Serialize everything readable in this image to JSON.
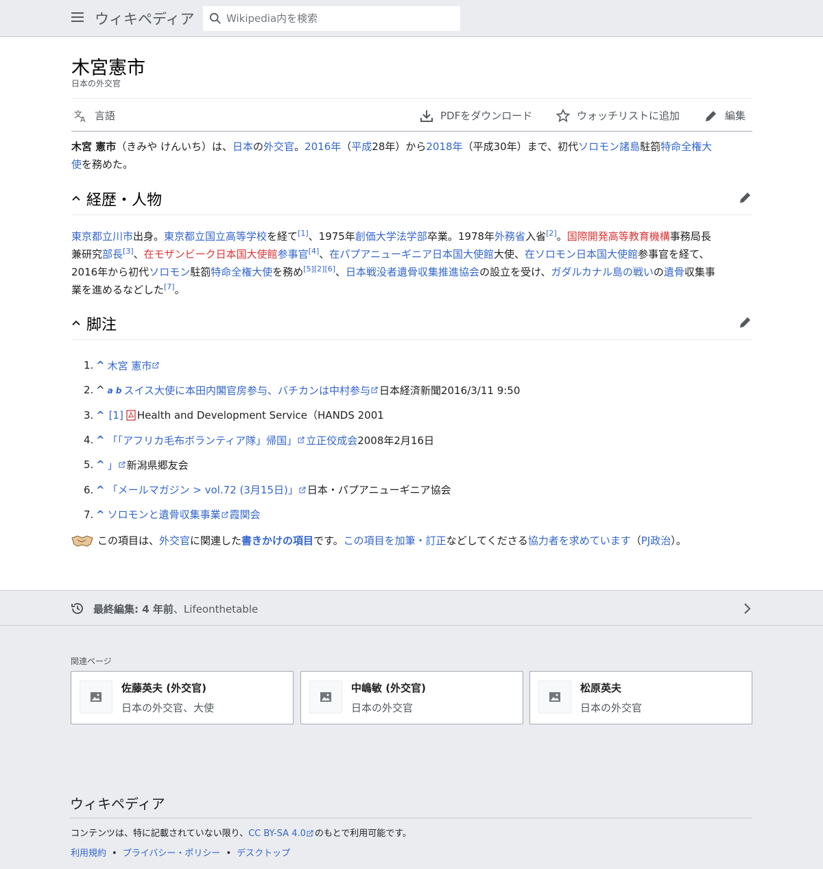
{
  "header": {
    "logo": "ウィキペディア",
    "search_placeholder": "Wikipedia内を検索"
  },
  "article": {
    "title": "木宮憲市",
    "tagline": "日本の外交官",
    "toolbar": {
      "language": "言語",
      "download_pdf": "PDFをダウンロード",
      "watchlist": "ウォッチリストに追加",
      "edit": "編集"
    },
    "lead": {
      "name": "木宮 憲市",
      "reading": "（きみや けんいち）は、",
      "japan": "日本",
      "no": "の",
      "diplomat": "外交官",
      "dot1": "。",
      "y2016": "2016年",
      "paren_open": "（",
      "heisei": "平成",
      "h28": "28年）から",
      "y2018": "2018年",
      "h30": "（平成30年）まで、初代",
      "solomon_islands": "ソロモン諸島",
      "chuzai": "駐箚",
      "ambassador_a": "特命全権大",
      "ambassador_b": "使",
      "served": "を務めた。"
    },
    "section1": {
      "heading": "経歴・人物",
      "t1": "東京都立川市",
      "t2": "出身。",
      "t3": "東京都立国立高等学校",
      "t4": "を経て",
      "r1": "[1]",
      "t5": "、1975年",
      "t6": "創価大学法学部",
      "t7": "卒業。1978年",
      "t8": "外務省",
      "t9": "入省",
      "r2": "[2]",
      "t10": "。",
      "t11": "国際開発高等教育機構",
      "t12": "事務局長",
      "t13": "兼研究",
      "t14": "部長",
      "r3": "[3]",
      "t15": "、",
      "t16": "在モザンビーク日本国大使館",
      "t17": "参事官",
      "r4": "[4]",
      "t18": "、",
      "t19": "在パプアニューギニア日本国大使館",
      "t20": "大使、",
      "t21": "在ソロモン日本国大使館",
      "t22": "参事官を経て、",
      "t23": "2016年から初代",
      "t24": "ソロモン",
      "t25": "駐箚",
      "t26": "特命全権大使",
      "t27": "を務め",
      "r5": "[5]",
      "r2b": "[2]",
      "r6": "[6]",
      "t28": "、",
      "t29": "日本戦没者遺骨収集推進協会",
      "t30": "の設立を受け、",
      "t31": "ガダルカナル島の戦い",
      "t32": "の",
      "t33": "遺骨",
      "t34": "収集事",
      "t35": "業を進めるなどした",
      "r7": "[7]",
      "t36": "。"
    },
    "section2": {
      "heading": "脚注",
      "refs": [
        {
          "num": "1.",
          "caret": "^",
          "link": "木宮 憲市",
          "rest": ""
        },
        {
          "num": "2.",
          "caret": "^",
          "ab": "a b",
          "link": "スイス大使に本田内閣官房参与、バチカンは中村参与",
          "rest": "日本経済新聞2016/3/11 9:50"
        },
        {
          "num": "3.",
          "caret": "^",
          "link": "[1]",
          "rest": "Health and Development Service（HANDS 2001"
        },
        {
          "num": "4.",
          "caret": "^",
          "link": "「「アフリカ毛布ボランティア隊」帰国」",
          "link2": "立正佼成会",
          "rest": "2008年2月16日"
        },
        {
          "num": "5.",
          "caret": "^",
          "link": "」",
          "rest": "新潟県郷友会"
        },
        {
          "num": "6.",
          "caret": "^",
          "link": "「メールマガジン > vol.72 (3月15日)」",
          "rest": "日本・パプアニューギニア協会"
        },
        {
          "num": "7.",
          "caret": "^",
          "link": "ソロモンと遺骨収集事業",
          "link2": "霞関会",
          "rest": ""
        }
      ]
    },
    "stub": {
      "s1": "この項目は、",
      "s2": "外交官",
      "s3": "に関連した",
      "s4": "書きかけの項目",
      "s5": "です。",
      "s6": "この項目を加筆・訂正",
      "s7": "などしてくださる",
      "s8": "協力者を求めています",
      "s9": "（",
      "s10": "PJ政治",
      "s11": "）。"
    }
  },
  "last_edited": {
    "label": "最終編集: 4 年前",
    "user": "、Lifeonthetable"
  },
  "related": {
    "heading": "関連ページ",
    "cards": [
      {
        "title": "佐藤英夫 (外交官)",
        "desc": "日本の外交官、大使"
      },
      {
        "title": "中嶋敏 (外交官)",
        "desc": "日本の外交官"
      },
      {
        "title": "松原英夫",
        "desc": "日本の外交官"
      }
    ]
  },
  "footer": {
    "logo": "ウィキペディア",
    "license_pre": "コンテンツは、特に記載されていない限り、",
    "license_link": "CC BY-SA 4.0",
    "license_post": "のもとで利用可能です。",
    "links": [
      "利用規約",
      "プライバシー・ポリシー",
      "デスクトップ"
    ],
    "sep": "•"
  },
  "colors": {
    "link": "#3366cc",
    "redlink": "#dd3333",
    "chrome": "#eaecf0"
  }
}
